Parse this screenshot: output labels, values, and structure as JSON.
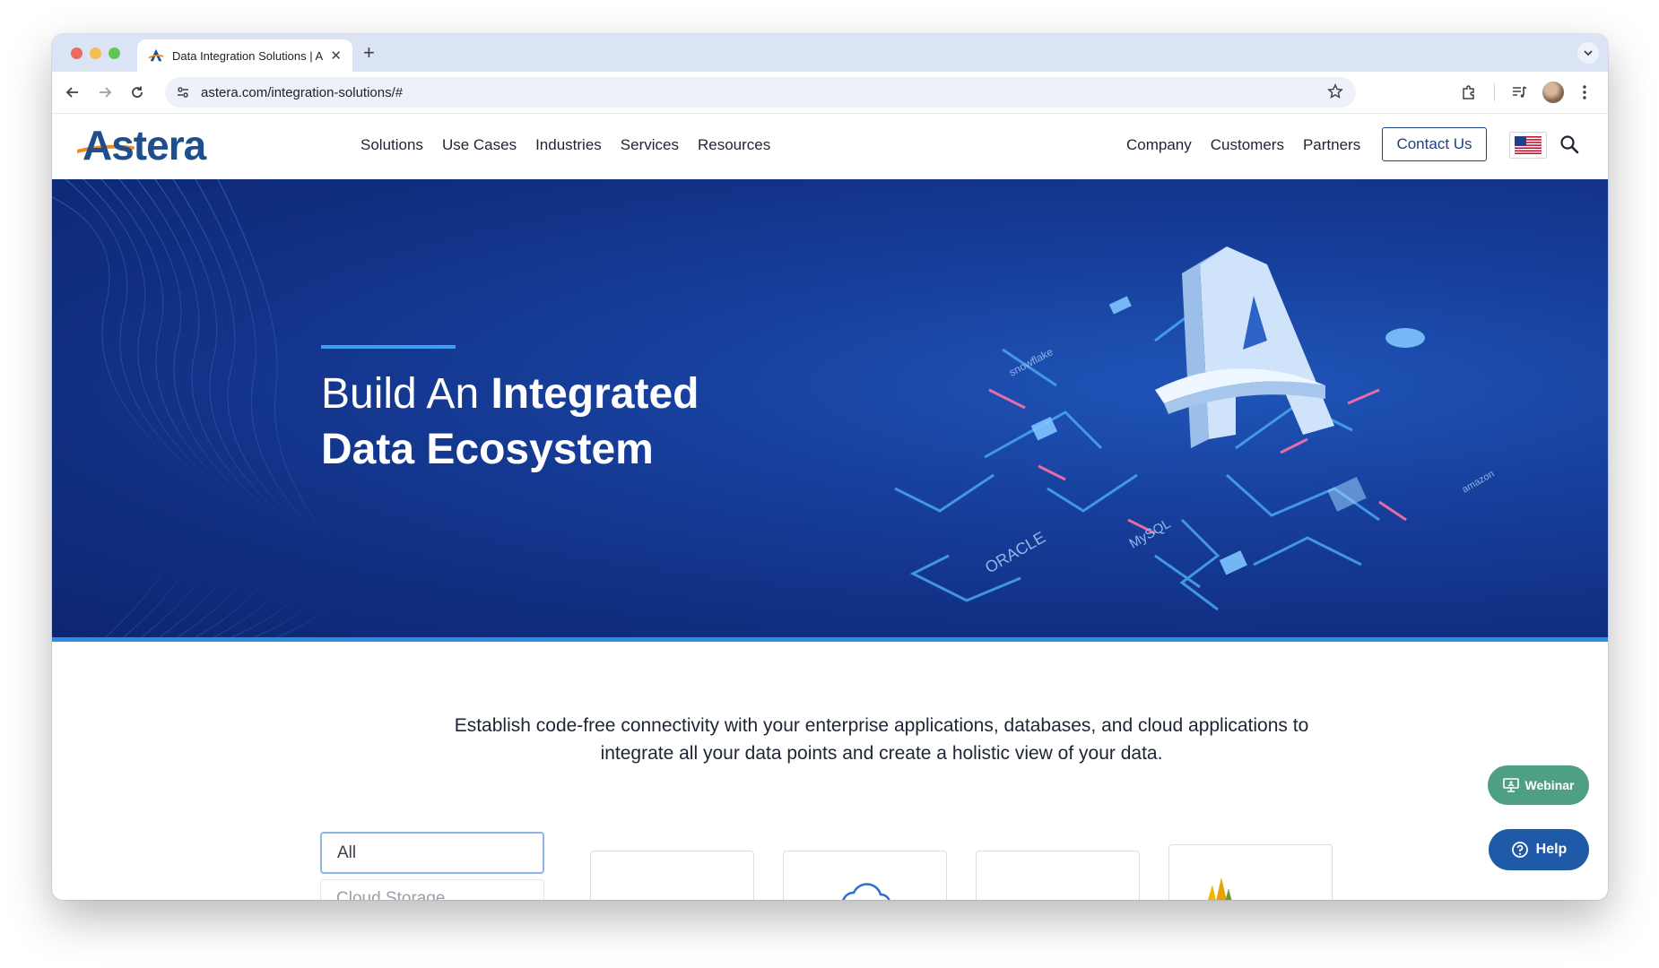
{
  "browser": {
    "tab_title": "Data Integration Solutions | A",
    "url": "astera.com/integration-solutions/#"
  },
  "site": {
    "logo_text": "Astera",
    "nav_left": [
      "Solutions",
      "Use Cases",
      "Industries",
      "Services",
      "Resources"
    ],
    "nav_right": [
      "Company",
      "Customers",
      "Partners"
    ],
    "contact_label": "Contact Us"
  },
  "hero": {
    "title_light": "Build An ",
    "title_bold_1": "Integrated",
    "title_bold_2": "Data Ecosystem",
    "art_labels": {
      "oracle": "ORACLE",
      "mysql": "MySQL",
      "snowflake": "snowflake",
      "amazon": "amazon"
    }
  },
  "intro": {
    "text": "Establish code-free connectivity with your enterprise applications, databases, and cloud applications to integrate all your data points and create a holistic view of your data."
  },
  "filter": {
    "selected": "All",
    "next": "Cloud Storage"
  },
  "floating": {
    "webinar_label": "Webinar",
    "help_label": "Help"
  },
  "colors": {
    "brand_blue": "#1f4e8c",
    "hero_blue": "#112f82",
    "accent_line": "#39a0f3",
    "webinar_green": "#4f9f86",
    "help_blue": "#1f5aa8"
  }
}
